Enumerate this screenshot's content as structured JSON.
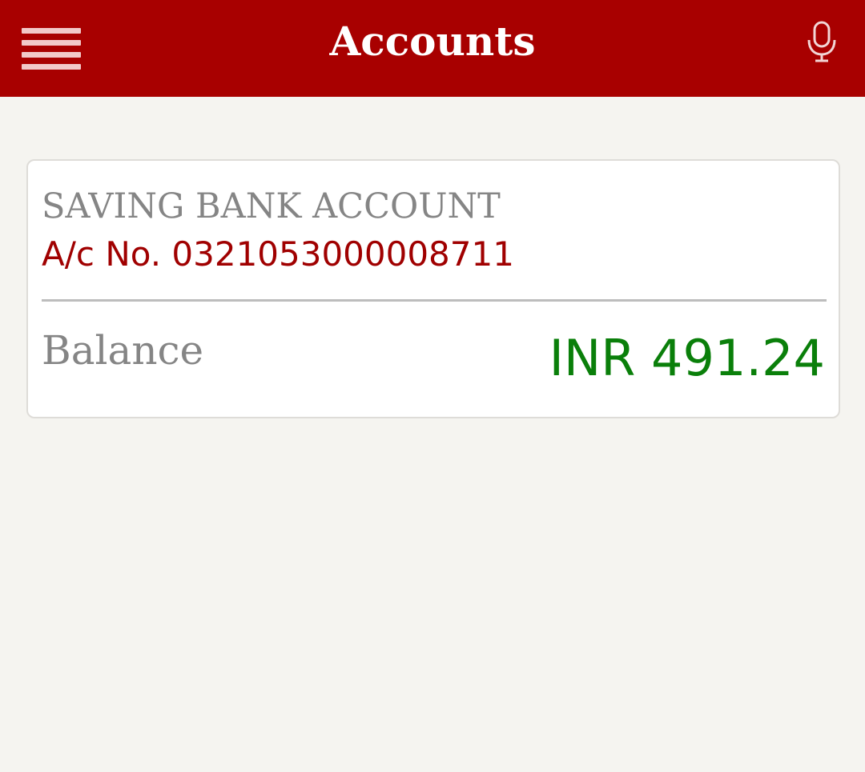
{
  "appbar": {
    "title": "Accounts",
    "menu_icon": "hamburger-menu-icon",
    "mic_icon": "microphone-icon",
    "background_color": "#a80000"
  },
  "account": {
    "type": "SAVING BANK ACCOUNT",
    "number_text": "A/c No. 0321053000008711",
    "balance_label": "Balance",
    "balance_value": "INR 491.24",
    "balance_color": "#0a7f0a",
    "number_color": "#a00000"
  }
}
